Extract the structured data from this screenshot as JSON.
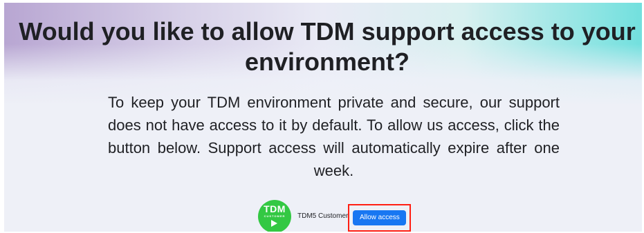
{
  "dialog": {
    "headline": "Would you like to allow TDM support access to your environment?",
    "body": "To keep your TDM environment private and secure, our support does not have access to it by default. To allow us access, click the button below. Support access will automatically expire after one week.",
    "account": {
      "logo_title": "TDM",
      "logo_subtitle": "CUSTOMER",
      "logo_icon": "play-icon",
      "name": "TDM5 Customer"
    },
    "allow_button_label": "Allow access",
    "colors": {
      "accent": "#1877f2",
      "logo_green": "#33c843",
      "highlight_red": "#ff1e12",
      "text": "#1f2024"
    }
  }
}
